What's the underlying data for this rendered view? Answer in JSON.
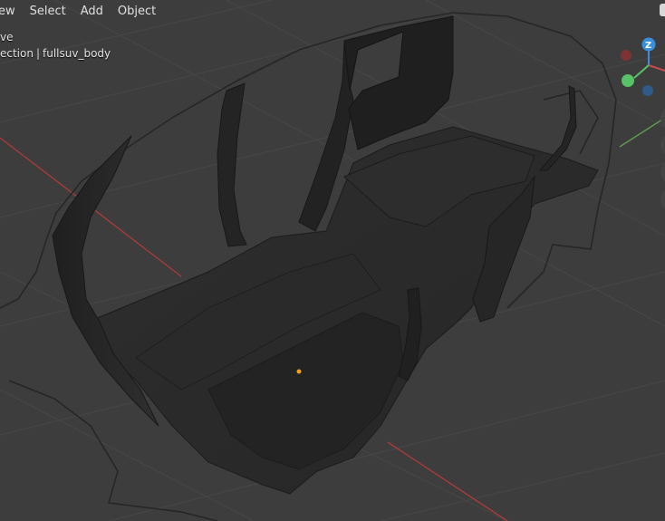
{
  "header": {
    "menus": [
      "ew",
      "Select",
      "Add",
      "Object"
    ]
  },
  "overlay": {
    "mode_text": "ve",
    "collection_text": "ection",
    "separator": "|",
    "object_name": "fullsuv_body"
  },
  "gizmo": {
    "z_label": "Z",
    "x_color": "#c94a4a",
    "y_color": "#58c267",
    "z_color": "#3a8fdc"
  },
  "colors": {
    "background": "#3d3d3d",
    "grid": "#484848",
    "x_axis": "#a83b3b",
    "y_axis": "#5e9c51",
    "mesh": "#2b2b2b",
    "outline": "#1e1e1e",
    "origin": "#f0a020"
  }
}
